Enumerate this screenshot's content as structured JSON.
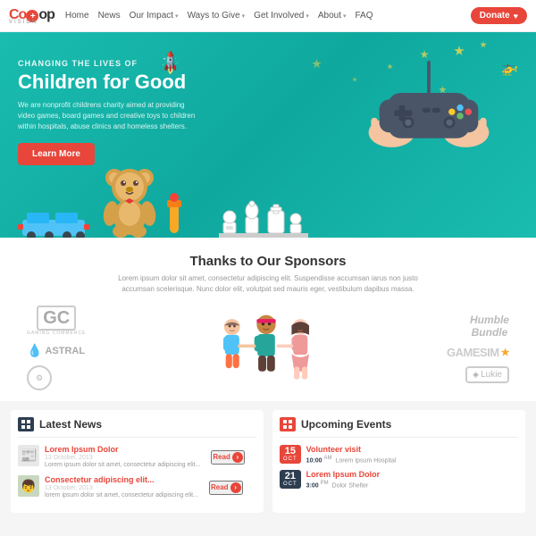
{
  "nav": {
    "logo": {
      "co": "Co",
      "op": "p",
      "vision": "VISION"
    },
    "links": [
      {
        "label": "Home",
        "hasDropdown": false
      },
      {
        "label": "News",
        "hasDropdown": false
      },
      {
        "label": "Our Impact",
        "hasDropdown": true
      },
      {
        "label": "Ways to Give",
        "hasDropdown": true
      },
      {
        "label": "Get Involved",
        "hasDropdown": true
      },
      {
        "label": "About",
        "hasDropdown": true
      },
      {
        "label": "FAQ",
        "hasDropdown": false
      }
    ],
    "donate_label": "Donate"
  },
  "hero": {
    "subtitle": "Changing the lives of",
    "title": "Children for Good",
    "description": "We are nonprofit childrens charity aimed at providing video games, board games and creative toys to children within hospitals, abuse clinics and homeless shelters.",
    "cta_label": "Learn More"
  },
  "sponsors": {
    "title": "Thanks to Our Sponsors",
    "description": "Lorem ipsum dolor sit amet, consectetur adipiscing elit. Suspendisse accumsan iarus non justo accumsan scelerisque. Nunc dolor elit, volutpat sed mauris eger, vestibulum dapibus massa.",
    "logos": [
      {
        "name": "GC Gaming Commerce",
        "type": "gc"
      },
      {
        "name": "Astral",
        "type": "astral"
      },
      {
        "name": "Badge",
        "type": "badge"
      },
      {
        "name": "Humble Bundle",
        "type": "humble"
      },
      {
        "name": "GameSim",
        "type": "gamesim"
      },
      {
        "name": "Lukie",
        "type": "lukie"
      }
    ]
  },
  "news": {
    "section_title": "Latest News",
    "icon_label": "NEWS",
    "items": [
      {
        "title": "Lorem Ipsum Dolor",
        "date": "13 October, 2013",
        "excerpt": "Lorem ipsum dolor sit amet, consectetur adipiscing elit...",
        "read_label": "Read",
        "has_thumb": false
      },
      {
        "title": "Consectetur adipiscing elit...",
        "date": "13 October, 2013",
        "excerpt": "lorem ipsum dolor sit amet, consectetur adipiscing elit...",
        "read_label": "Read",
        "has_thumb": true
      }
    ]
  },
  "events": {
    "section_title": "Upcoming Events",
    "icon_label": "EVENTS",
    "items": [
      {
        "day": "15",
        "month": "OCT",
        "title": "Volunteer visit",
        "time_num": "10:00",
        "time_ampm": "AM",
        "location": "Lorem Ipsum Hospital"
      },
      {
        "day": "21",
        "month": "OCT",
        "title": "Lorem Ipsum Dolor",
        "time_num": "3:00",
        "time_ampm": "PM",
        "location": "Dolor Shelter"
      }
    ]
  }
}
